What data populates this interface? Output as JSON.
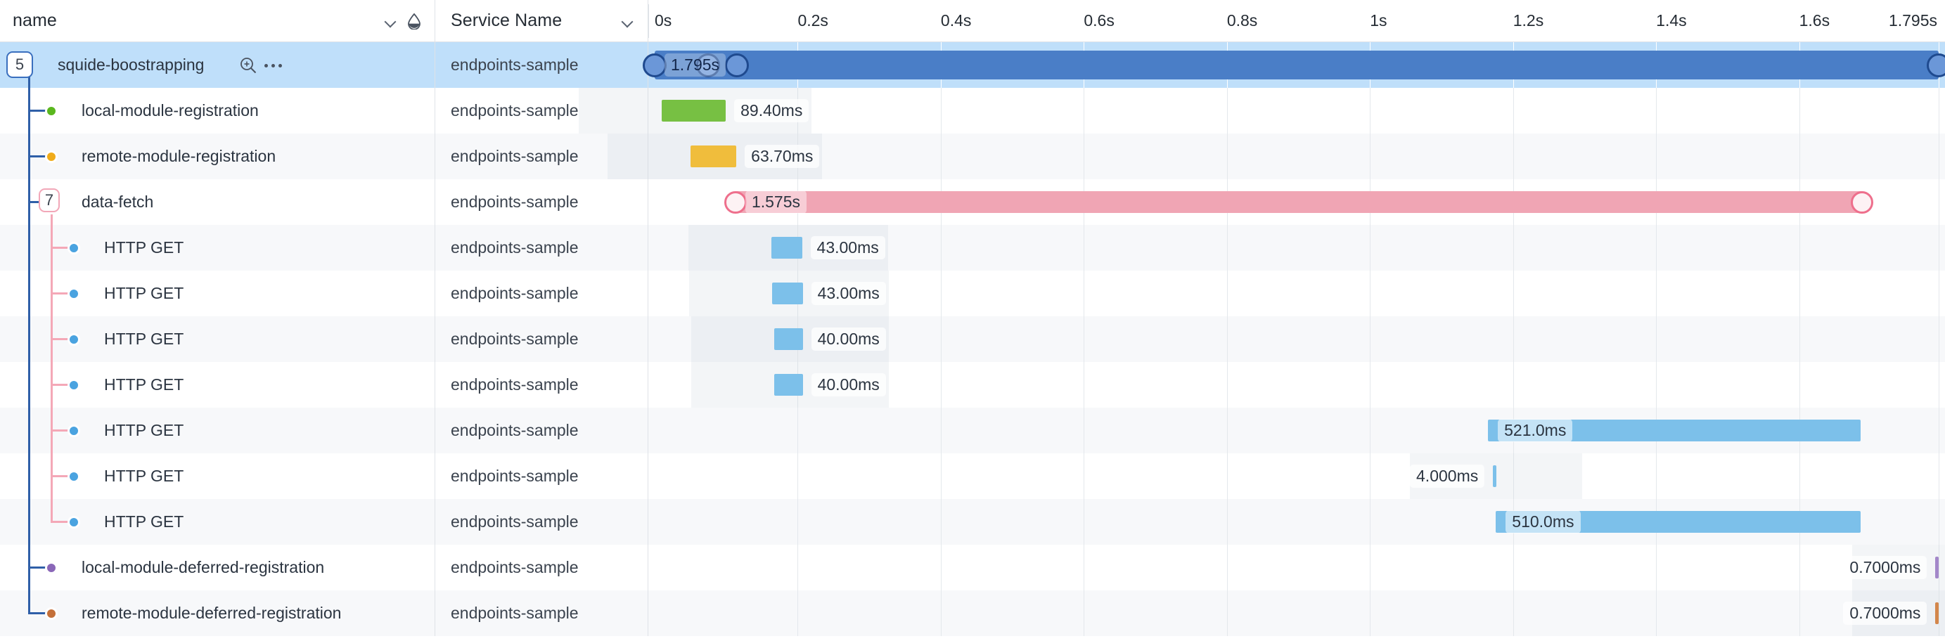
{
  "header": {
    "columns": [
      {
        "label": "name",
        "icons": [
          "chevron-down-icon",
          "droplet-theme-icon"
        ]
      },
      {
        "label": "Service Name",
        "icons": [
          "chevron-down-icon"
        ]
      }
    ],
    "ticks": [
      {
        "label": "0s",
        "x": 0
      },
      {
        "label": "0.2s",
        "x": 0.2
      },
      {
        "label": "0.4s",
        "x": 0.4
      },
      {
        "label": "0.6s",
        "x": 0.6
      },
      {
        "label": "0.8s",
        "x": 0.8
      },
      {
        "label": "1s",
        "x": 1.0
      },
      {
        "label": "1.2s",
        "x": 1.2
      },
      {
        "label": "1.4s",
        "x": 1.4
      },
      {
        "label": "1.6s",
        "x": 1.6
      },
      {
        "label": "1.795s",
        "x": 1.795
      }
    ],
    "total_duration": "1.795s"
  },
  "colors": {
    "selected_row": "#bfdffa",
    "root_bar": "#4a7ec7",
    "green": "#77c043",
    "amber": "#f0bd3c",
    "pink": "#f0a5b4",
    "blue": "#7cc0ea",
    "purple": "#a387c9",
    "orange": "#d3864b",
    "tree_blue": "#2f5fa8",
    "tree_pink": "#f4a8b7"
  },
  "rows": [
    {
      "name": "squide-boostrapping",
      "service": "endpoints-sample",
      "depth": 0,
      "badge": "5",
      "badge_style": "blue",
      "selected": true,
      "tools": [
        "zoom-in-icon",
        "more-options-icon"
      ],
      "bar": {
        "start": 0.0,
        "end": 1.795,
        "color": "root_bar",
        "style": "big",
        "label": "1.795s",
        "label_pos": "inside",
        "markers": [
          0.0,
          0.075,
          0.115,
          1.795
        ]
      }
    },
    {
      "name": "local-module-registration",
      "service": "endpoints-sample",
      "depth": 1,
      "dot_color": "#5ab71e",
      "bar": {
        "start": 0.01,
        "end": 0.0994,
        "color": "green",
        "label": "89.40ms",
        "label_pos": "right"
      }
    },
    {
      "name": "remote-module-registration",
      "service": "endpoints-sample",
      "depth": 1,
      "dot_color": "#f0ac1a",
      "bar": {
        "start": 0.0505,
        "end": 0.1142,
        "color": "amber",
        "label": "63.70ms",
        "label_pos": "right"
      }
    },
    {
      "name": "data-fetch",
      "service": "endpoints-sample",
      "depth": 1,
      "badge": "7",
      "badge_style": "pink",
      "bar": {
        "start": 0.113,
        "end": 1.688,
        "color": "pink",
        "label": "1.575s",
        "label_pos": "inside",
        "markers": [
          0.113,
          1.688
        ]
      }
    },
    {
      "name": "HTTP GET",
      "service": "endpoints-sample",
      "depth": 2,
      "dot_color": "#4aa3e0",
      "bar": {
        "start": 0.163,
        "end": 0.206,
        "color": "blue",
        "label": "43.00ms",
        "label_pos": "right"
      }
    },
    {
      "name": "HTTP GET",
      "service": "endpoints-sample",
      "depth": 2,
      "dot_color": "#4aa3e0",
      "bar": {
        "start": 0.164,
        "end": 0.207,
        "color": "blue",
        "label": "43.00ms",
        "label_pos": "right"
      }
    },
    {
      "name": "HTTP GET",
      "service": "endpoints-sample",
      "depth": 2,
      "dot_color": "#4aa3e0",
      "bar": {
        "start": 0.167,
        "end": 0.207,
        "color": "blue",
        "label": "40.00ms",
        "label_pos": "right"
      }
    },
    {
      "name": "HTTP GET",
      "service": "endpoints-sample",
      "depth": 2,
      "dot_color": "#4aa3e0",
      "bar": {
        "start": 0.167,
        "end": 0.207,
        "color": "blue",
        "label": "40.00ms",
        "label_pos": "right"
      }
    },
    {
      "name": "HTTP GET",
      "service": "endpoints-sample",
      "depth": 2,
      "dot_color": "#4aa3e0",
      "bar": {
        "start": 1.165,
        "end": 1.686,
        "color": "blue",
        "label": "521.0ms",
        "label_pos": "inside"
      }
    },
    {
      "name": "HTTP GET",
      "service": "endpoints-sample",
      "depth": 2,
      "dot_color": "#4aa3e0",
      "bar": {
        "start": 1.172,
        "end": 1.176,
        "color": "blue",
        "label": "4.000ms",
        "label_pos": "left"
      }
    },
    {
      "name": "HTTP GET",
      "service": "endpoints-sample",
      "depth": 2,
      "dot_color": "#4aa3e0",
      "bar": {
        "start": 1.176,
        "end": 1.686,
        "color": "blue",
        "label": "510.0ms",
        "label_pos": "inside"
      }
    },
    {
      "name": "local-module-deferred-registration",
      "service": "endpoints-sample",
      "depth": 1,
      "dot_color": "#8a67b8",
      "bar": {
        "start": 1.7905,
        "end": 1.7912,
        "color": "purple",
        "label": "0.7000ms",
        "label_pos": "left"
      }
    },
    {
      "name": "remote-module-deferred-registration",
      "service": "endpoints-sample",
      "depth": 1,
      "dot_color": "#c4703a",
      "bar": {
        "start": 1.7905,
        "end": 1.7912,
        "color": "orange",
        "label": "0.7000ms",
        "label_pos": "left"
      }
    }
  ]
}
